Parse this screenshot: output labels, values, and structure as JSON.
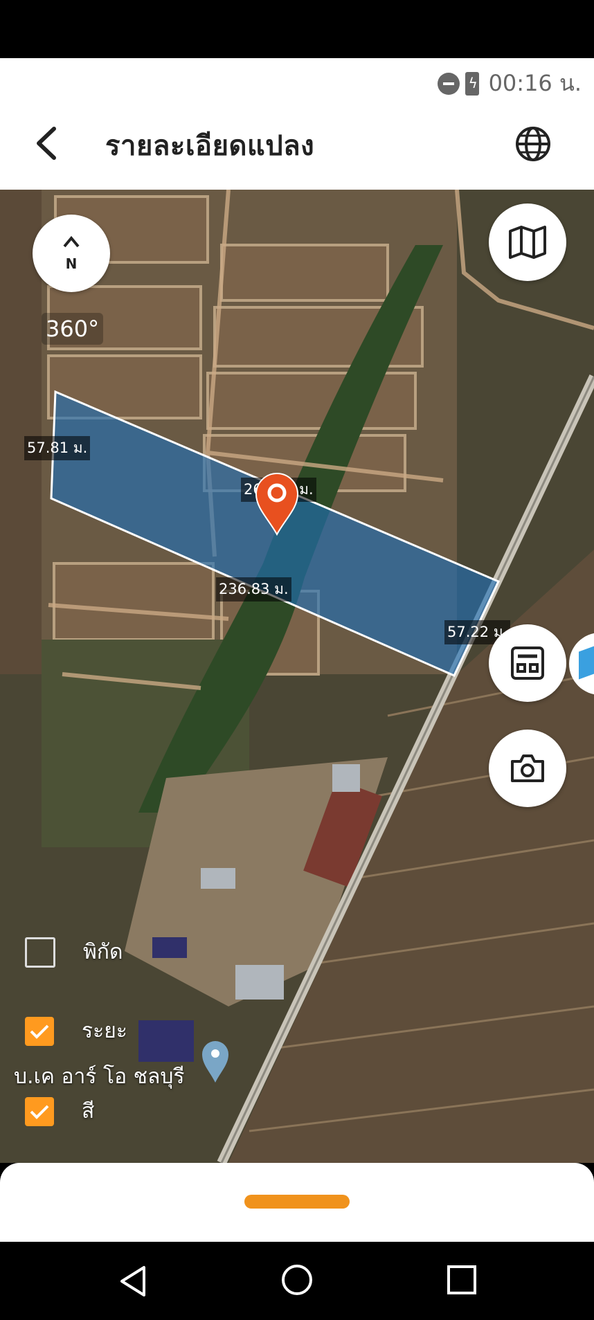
{
  "status": {
    "time": "00:16 น."
  },
  "header": {
    "title": "รายละเอียดแปลง"
  },
  "map": {
    "compass_label": "N",
    "view_mode": "360°",
    "plot": {
      "edge_left": "57.81 ม.",
      "edge_top": "260.36 ม.",
      "edge_bottom": "236.83 ม.",
      "edge_right": "57.22 ม."
    },
    "place_label": "บ.เค อาร์ โอ ชลบุรี",
    "layers": [
      {
        "label": "พิกัด",
        "checked": false
      },
      {
        "label": "ระยะ",
        "checked": true
      },
      {
        "label": "สี",
        "checked": true
      }
    ]
  },
  "colors": {
    "accent": "#F0921C",
    "plot_fill": "#1E6FB8",
    "pin": "#E8501F"
  },
  "icons": [
    "back-arrow-icon",
    "globe-icon",
    "map-icon",
    "calculator-icon",
    "camera-icon",
    "location-pin-icon",
    "check-icon",
    "nav-back-icon",
    "nav-home-icon",
    "nav-recents-icon"
  ]
}
